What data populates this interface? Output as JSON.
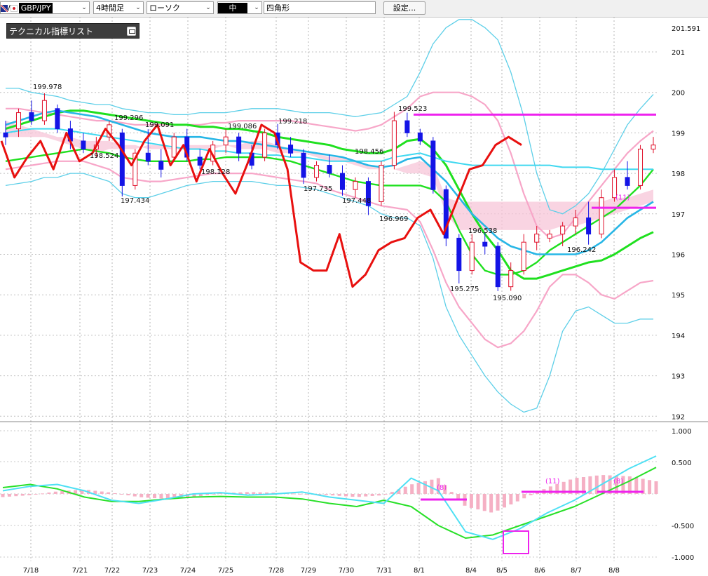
{
  "toolbar": {
    "symbol": "GBP/JPY",
    "timeframe": "4時間足",
    "chart_type": "ローソク",
    "style_value": "中",
    "drawing_tool": "四角形",
    "settings_button": "設定..."
  },
  "indicator_panel": {
    "title": "テクニカル指標リスト"
  },
  "colors": {
    "up_candle": "#e0102a",
    "down_candle": "#1414e6",
    "bb_outer": "#5dcfe8",
    "bb_2sigma": "#f7a6c8",
    "ma_green": "#1fe01f",
    "ma_cyan": "#40d8f0",
    "ma_blue": "#27b6e6",
    "oscillator_red": "#e8100f",
    "cloud": "#f7c6d8",
    "magenta": "#ee22ee",
    "macd_line": "#4ee0f4",
    "signal_line": "#28e028",
    "histogram": "#f5b0c4"
  },
  "chart_data": [
    {
      "type": "candlestick",
      "title": "",
      "x_ticks": [
        "7/18",
        "7/21",
        "7/22",
        "7/23",
        "7/24",
        "7/25",
        "7/28",
        "7/29",
        "7/30",
        "7/31",
        "8/1",
        "8/4",
        "8/5",
        "8/6",
        "8/7",
        "8/8"
      ],
      "y_ticks": [
        "201.591",
        "201",
        "200",
        "199",
        "198",
        "197",
        "196",
        "195",
        "194",
        "193",
        "192"
      ],
      "ylim": [
        191.8,
        201.8
      ],
      "grid": true,
      "price_labels": [
        "199.978",
        "199.296",
        "198.524",
        "199.091",
        "197.434",
        "198.128",
        "199.086",
        "199.218",
        "197.735",
        "198.456",
        "197.448",
        "196.969",
        "199.523",
        "196.538",
        "195.275",
        "195.090",
        "196.242"
      ],
      "annotations": [
        "(11)"
      ],
      "candles": [
        {
          "x": 1,
          "o": 199.0,
          "h": 199.3,
          "l": 198.7,
          "c": 198.9
        },
        {
          "x": 2,
          "o": 199.1,
          "h": 199.6,
          "l": 198.9,
          "c": 199.5
        },
        {
          "x": 3,
          "o": 199.5,
          "h": 199.8,
          "l": 199.2,
          "c": 199.3
        },
        {
          "x": 4,
          "o": 199.3,
          "h": 199.98,
          "l": 199.2,
          "c": 199.8
        },
        {
          "x": 5,
          "o": 199.6,
          "h": 199.7,
          "l": 199.0,
          "c": 199.1
        },
        {
          "x": 6,
          "o": 199.1,
          "h": 199.3,
          "l": 198.6,
          "c": 198.8
        },
        {
          "x": 7,
          "o": 198.8,
          "h": 199.0,
          "l": 198.5,
          "c": 198.6
        },
        {
          "x": 8,
          "o": 198.6,
          "h": 198.9,
          "l": 198.4,
          "c": 198.7
        },
        {
          "x": 9,
          "o": 198.9,
          "h": 199.3,
          "l": 198.8,
          "c": 199.2
        },
        {
          "x": 10,
          "o": 199.0,
          "h": 199.1,
          "l": 197.43,
          "c": 197.7
        },
        {
          "x": 11,
          "o": 197.7,
          "h": 198.6,
          "l": 197.6,
          "c": 198.5
        },
        {
          "x": 12,
          "o": 198.5,
          "h": 199.09,
          "l": 198.2,
          "c": 198.3
        },
        {
          "x": 13,
          "o": 198.3,
          "h": 198.6,
          "l": 197.9,
          "c": 198.1
        },
        {
          "x": 14,
          "o": 198.4,
          "h": 199.0,
          "l": 198.3,
          "c": 198.9
        },
        {
          "x": 15,
          "o": 198.9,
          "h": 199.1,
          "l": 198.3,
          "c": 198.4
        },
        {
          "x": 16,
          "o": 198.4,
          "h": 198.6,
          "l": 198.1,
          "c": 198.2
        },
        {
          "x": 17,
          "o": 198.3,
          "h": 198.8,
          "l": 198.2,
          "c": 198.7
        },
        {
          "x": 18,
          "o": 198.7,
          "h": 199.09,
          "l": 198.5,
          "c": 198.9
        },
        {
          "x": 19,
          "o": 198.9,
          "h": 199.0,
          "l": 198.3,
          "c": 198.5
        },
        {
          "x": 20,
          "o": 198.5,
          "h": 198.7,
          "l": 198.1,
          "c": 198.2
        },
        {
          "x": 21,
          "o": 198.4,
          "h": 199.1,
          "l": 198.3,
          "c": 199.0
        },
        {
          "x": 22,
          "o": 199.0,
          "h": 199.22,
          "l": 198.6,
          "c": 198.7
        },
        {
          "x": 23,
          "o": 198.7,
          "h": 198.9,
          "l": 198.4,
          "c": 198.5
        },
        {
          "x": 24,
          "o": 198.5,
          "h": 198.6,
          "l": 197.74,
          "c": 197.9
        },
        {
          "x": 25,
          "o": 197.9,
          "h": 198.3,
          "l": 197.8,
          "c": 198.2
        },
        {
          "x": 26,
          "o": 198.2,
          "h": 198.46,
          "l": 197.9,
          "c": 198.0
        },
        {
          "x": 27,
          "o": 198.0,
          "h": 198.2,
          "l": 197.45,
          "c": 197.6
        },
        {
          "x": 28,
          "o": 197.6,
          "h": 197.9,
          "l": 197.4,
          "c": 197.8
        },
        {
          "x": 29,
          "o": 197.8,
          "h": 197.9,
          "l": 196.97,
          "c": 197.2
        },
        {
          "x": 30,
          "o": 197.3,
          "h": 198.3,
          "l": 197.2,
          "c": 198.2
        },
        {
          "x": 31,
          "o": 198.2,
          "h": 199.52,
          "l": 198.1,
          "c": 199.3
        },
        {
          "x": 32,
          "o": 199.3,
          "h": 199.5,
          "l": 198.9,
          "c": 199.0
        },
        {
          "x": 33,
          "o": 199.0,
          "h": 199.1,
          "l": 198.7,
          "c": 198.8
        },
        {
          "x": 34,
          "o": 198.8,
          "h": 198.9,
          "l": 197.5,
          "c": 197.6
        },
        {
          "x": 35,
          "o": 197.6,
          "h": 197.7,
          "l": 196.2,
          "c": 196.4
        },
        {
          "x": 36,
          "o": 196.4,
          "h": 196.5,
          "l": 195.28,
          "c": 195.6
        },
        {
          "x": 37,
          "o": 195.6,
          "h": 196.5,
          "l": 195.5,
          "c": 196.3
        },
        {
          "x": 38,
          "o": 196.3,
          "h": 196.54,
          "l": 196.0,
          "c": 196.2
        },
        {
          "x": 39,
          "o": 196.2,
          "h": 196.3,
          "l": 195.09,
          "c": 195.2
        },
        {
          "x": 40,
          "o": 195.2,
          "h": 195.8,
          "l": 195.1,
          "c": 195.6
        },
        {
          "x": 41,
          "o": 195.6,
          "h": 196.5,
          "l": 195.5,
          "c": 196.3
        },
        {
          "x": 42,
          "o": 196.3,
          "h": 196.7,
          "l": 196.1,
          "c": 196.5
        },
        {
          "x": 43,
          "o": 196.4,
          "h": 196.6,
          "l": 196.3,
          "c": 196.5
        },
        {
          "x": 44,
          "o": 196.5,
          "h": 196.8,
          "l": 196.2,
          "c": 196.7
        },
        {
          "x": 45,
          "o": 196.7,
          "h": 197.1,
          "l": 196.5,
          "c": 196.9
        },
        {
          "x": 46,
          "o": 196.9,
          "h": 197.3,
          "l": 196.24,
          "c": 196.5
        },
        {
          "x": 47,
          "o": 196.5,
          "h": 197.6,
          "l": 196.4,
          "c": 197.4
        },
        {
          "x": 48,
          "o": 197.4,
          "h": 198.1,
          "l": 197.3,
          "c": 197.9
        },
        {
          "x": 49,
          "o": 197.9,
          "h": 198.3,
          "l": 197.6,
          "c": 197.7
        },
        {
          "x": 50,
          "o": 197.7,
          "h": 198.7,
          "l": 197.6,
          "c": 198.6
        },
        {
          "x": 51,
          "o": 198.6,
          "h": 198.9,
          "l": 198.5,
          "c": 198.7
        }
      ]
    },
    {
      "type": "line",
      "title": "",
      "y_ticks": [
        "1.000",
        "0.500",
        "-0.500",
        "-1.000"
      ],
      "ylim": [
        -1.0,
        1.0
      ],
      "annotations": [
        "(8)",
        "(11)",
        "(8)"
      ],
      "series": [
        {
          "values": [
            0.05,
            0.12,
            0.15,
            0.05,
            -0.1,
            -0.15,
            -0.08,
            0.0,
            0.02,
            -0.02,
            0.0,
            0.03,
            -0.05,
            -0.1,
            -0.15,
            0.25,
            0.05,
            -0.6,
            -0.72,
            -0.55,
            -0.3,
            -0.1,
            0.15,
            0.4,
            0.6
          ]
        },
        {
          "values": [
            0.1,
            0.15,
            0.08,
            -0.05,
            -0.12,
            -0.12,
            -0.08,
            -0.05,
            -0.04,
            -0.05,
            -0.05,
            -0.08,
            -0.15,
            -0.2,
            -0.1,
            -0.2,
            -0.5,
            -0.7,
            -0.65,
            -0.5,
            -0.35,
            -0.2,
            0.0,
            0.2,
            0.42
          ]
        },
        {
          "values": [
            -0.05,
            -0.02,
            0.04,
            0.07,
            0.02,
            -0.05,
            -0.08,
            -0.05,
            0.01,
            0.03,
            0.02,
            0.0,
            -0.02,
            -0.05,
            -0.02,
            0.15,
            0.25,
            -0.2,
            -0.3,
            -0.1,
            0.1,
            0.25,
            0.3,
            0.28,
            0.2
          ]
        }
      ]
    }
  ]
}
